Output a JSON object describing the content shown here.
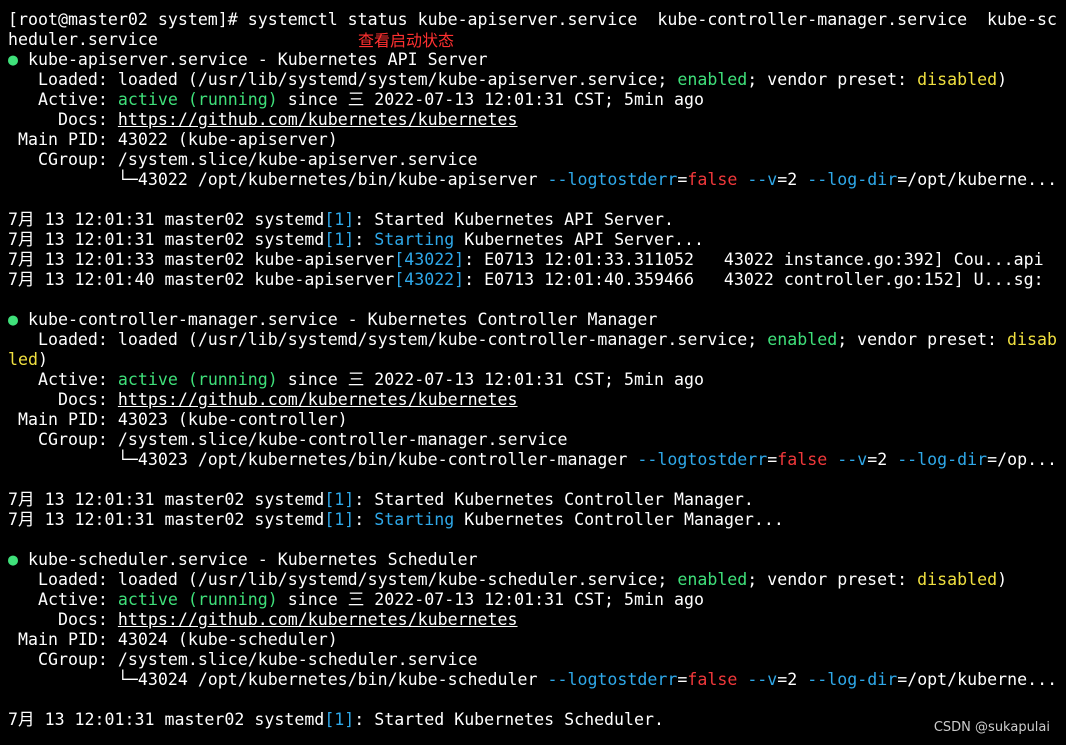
{
  "colors": {
    "background": "#000000",
    "text": "#ffffff",
    "green": "#3fe07a",
    "yellow": "#f0e040",
    "red": "#f0383a",
    "blue": "#2fa8e8",
    "annotation": "#ff3030"
  },
  "prompt": {
    "text": "[root@master02 system]# systemctl status kube-apiserver.service  kube-controller-manager.service  kube-sc",
    "wrap": "heduler.service"
  },
  "annotation": "查看启动状态",
  "watermark": "CSDN @sukapulai",
  "services": [
    {
      "title": "kube-apiserver.service - Kubernetes API Server",
      "loaded_pre": "   Loaded: loaded (/usr/lib/systemd/system/kube-apiserver.service; ",
      "enabled": "enabled",
      "vendor": "; vendor preset: ",
      "disabled": "disabled",
      "loaded_post": ")",
      "active_label": "   Active: ",
      "active_state": "active (running)",
      "since": " since 三 2022-07-13 12:01:31 CST; 5min ago",
      "docs_label": "     Docs: ",
      "docs_url": "https://github.com/kubernetes/kubernetes",
      "pid": " Main PID: 43022 (kube-apiserver)",
      "cgroup": "   CGroup: /system.slice/kube-apiserver.service",
      "proc_prefix": "           └─43022 /opt/kubernetes/bin/kube-apiserver ",
      "proc_tail": "/opt/kuberne...",
      "logs": [
        {
          "pre": "7月 13 12:01:31 master02 systemd",
          "bracket": "[1]",
          "mid": ": ",
          "highlight": "",
          "post": "Started Kubernetes API Server."
        },
        {
          "pre": "7月 13 12:01:31 master02 systemd",
          "bracket": "[1]",
          "mid": ": ",
          "highlight": "Starting",
          "post": " Kubernetes API Server..."
        },
        {
          "pre": "7月 13 12:01:33 master02 kube-apiserver",
          "bracket": "[43022]",
          "mid": ": ",
          "highlight": "",
          "post": "E0713 12:01:33.311052   43022 instance.go:392] Cou...api"
        },
        {
          "pre": "7月 13 12:01:40 master02 kube-apiserver",
          "bracket": "[43022]",
          "mid": ": ",
          "highlight": "",
          "post": "E0713 12:01:40.359466   43022 controller.go:152] U...sg:"
        }
      ]
    },
    {
      "title": "kube-controller-manager.service - Kubernetes Controller Manager",
      "loaded_pre": "   Loaded: loaded (/usr/lib/systemd/system/kube-controller-manager.service; ",
      "enabled": "enabled",
      "vendor": "; vendor preset: ",
      "disabled": "disab",
      "disabled_wrap": "led",
      "loaded_post": ")",
      "active_label": "   Active: ",
      "active_state": "active (running)",
      "since": " since 三 2022-07-13 12:01:31 CST; 5min ago",
      "docs_label": "     Docs: ",
      "docs_url": "https://github.com/kubernetes/kubernetes",
      "pid": " Main PID: 43023 (kube-controller)",
      "cgroup": "   CGroup: /system.slice/kube-controller-manager.service",
      "proc_prefix": "           └─43023 /opt/kubernetes/bin/kube-controller-manager ",
      "proc_tail": "/op...",
      "logs": [
        {
          "pre": "7月 13 12:01:31 master02 systemd",
          "bracket": "[1]",
          "mid": ": ",
          "highlight": "",
          "post": "Started Kubernetes Controller Manager."
        },
        {
          "pre": "7月 13 12:01:31 master02 systemd",
          "bracket": "[1]",
          "mid": ": ",
          "highlight": "Starting",
          "post": " Kubernetes Controller Manager..."
        }
      ]
    },
    {
      "title": "kube-scheduler.service - Kubernetes Scheduler",
      "loaded_pre": "   Loaded: loaded (/usr/lib/systemd/system/kube-scheduler.service; ",
      "enabled": "enabled",
      "vendor": "; vendor preset: ",
      "disabled": "disabled",
      "loaded_post": ")",
      "active_label": "   Active: ",
      "active_state": "active (running)",
      "since": " since 三 2022-07-13 12:01:31 CST; 5min ago",
      "docs_label": "     Docs: ",
      "docs_url": "https://github.com/kubernetes/kubernetes",
      "pid": " Main PID: 43024 (kube-scheduler)",
      "cgroup": "   CGroup: /system.slice/kube-scheduler.service",
      "proc_prefix": "           └─43024 /opt/kubernetes/bin/kube-scheduler ",
      "proc_tail": "/opt/kuberne...",
      "logs": [
        {
          "pre": "7月 13 12:01:31 master02 systemd",
          "bracket": "[1]",
          "mid": ": ",
          "highlight": "",
          "post": "Started Kubernetes Scheduler."
        }
      ]
    }
  ],
  "flags": {
    "logtostderr": "--logtostderr",
    "eq": "=",
    "false": "false",
    "v": "--v",
    "v_val": "=2",
    "logdir": "--log-dir",
    "logdir_eq": "="
  },
  "bullet": "● "
}
